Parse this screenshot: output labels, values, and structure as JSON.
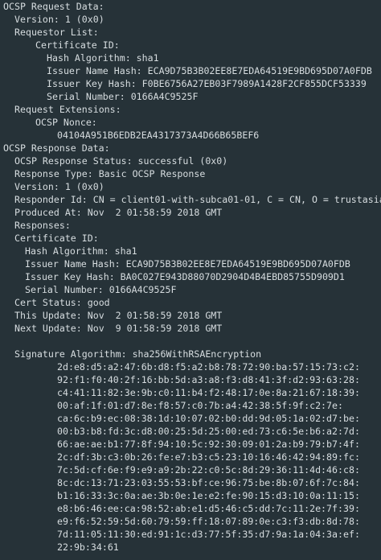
{
  "terminal": {
    "background": "#263238",
    "foreground": "#d7dde0",
    "lines": [
      {
        "indent": 0,
        "text": "OCSP Request Data:"
      },
      {
        "indent": 1,
        "text": "Version: 1 (0x0)"
      },
      {
        "indent": 1,
        "text": "Requestor List:"
      },
      {
        "indent": 3,
        "text": "Certificate ID:"
      },
      {
        "indent": 4,
        "text": "Hash Algorithm: sha1"
      },
      {
        "indent": 4,
        "text": "Issuer Name Hash: ECA9D75B3B02EE8E7EDA64519E9BD695D07A0FDB"
      },
      {
        "indent": 4,
        "text": "Issuer Key Hash: F0BE6756A27EB03F7989A1428F2CF855DCF53339"
      },
      {
        "indent": 4,
        "text": "Serial Number: 0166A4C9525F"
      },
      {
        "indent": 1,
        "text": "Request Extensions:"
      },
      {
        "indent": 3,
        "text": "OCSP Nonce:"
      },
      {
        "indent": 5,
        "text": "04104A951B6EDB2EA4317373A4D66B65BEF6"
      },
      {
        "indent": 0,
        "text": "OCSP Response Data:"
      },
      {
        "indent": 1,
        "text": "OCSP Response Status: successful (0x0)"
      },
      {
        "indent": 1,
        "text": "Response Type: Basic OCSP Response"
      },
      {
        "indent": 1,
        "text": "Version: 1 (0x0)"
      },
      {
        "indent": 1,
        "text": "Responder Id: CN = client01-with-subca01-01, C = CN, O = trustasia"
      },
      {
        "indent": 1,
        "text": "Produced At: Nov  2 01:58:59 2018 GMT"
      },
      {
        "indent": 1,
        "text": "Responses:"
      },
      {
        "indent": 1,
        "text": "Certificate ID:"
      },
      {
        "indent": 2,
        "text": "Hash Algorithm: sha1"
      },
      {
        "indent": 2,
        "text": "Issuer Name Hash: ECA9D75B3B02EE8E7EDA64519E9BD695D07A0FDB"
      },
      {
        "indent": 2,
        "text": "Issuer Key Hash: BA0C027E943D88070D2904D4B4EBD85755D909D1"
      },
      {
        "indent": 2,
        "text": "Serial Number: 0166A4C9525F"
      },
      {
        "indent": 1,
        "text": "Cert Status: good"
      },
      {
        "indent": 1,
        "text": "This Update: Nov  2 01:58:59 2018 GMT"
      },
      {
        "indent": 1,
        "text": "Next Update: Nov  9 01:58:59 2018 GMT"
      },
      {
        "indent": 0,
        "text": ""
      },
      {
        "indent": 1,
        "text": "Signature Algorithm: sha256WithRSAEncryption"
      },
      {
        "indent": 5,
        "text": "2d:e8:d5:a2:47:6b:d8:f5:a2:b8:78:72:90:ba:57:15:73:c2:"
      },
      {
        "indent": 5,
        "text": "92:f1:f0:40:2f:16:bb:5d:a3:a8:f3:d8:41:3f:d2:93:63:28:"
      },
      {
        "indent": 5,
        "text": "c4:41:11:82:3e:9b:c0:11:b4:f2:48:17:0e:8a:21:67:18:39:"
      },
      {
        "indent": 5,
        "text": "00:af:1f:01:d7:8e:f8:57:c0:7b:a4:42:38:5f:9f:c2:7e:"
      },
      {
        "indent": 5,
        "text": "ca:6c:b9:ec:08:38:1d:10:07:02:b0:dd:9d:05:1a:02:d7:be:"
      },
      {
        "indent": 5,
        "text": "00:b3:b8:fd:3c:d8:00:25:5d:25:00:ed:73:c6:5e:b6:a2:7d:"
      },
      {
        "indent": 5,
        "text": "66:ae:ae:b1:77:8f:94:10:5c:92:30:09:01:2a:b9:79:b7:4f:"
      },
      {
        "indent": 5,
        "text": "2c:df:3b:c3:0b:26:fe:e7:b3:c5:23:10:16:46:42:94:89:fc:"
      },
      {
        "indent": 5,
        "text": "7c:5d:cf:6e:f9:e9:a9:2b:22:c0:5c:8d:29:36:11:4d:46:c8:"
      },
      {
        "indent": 5,
        "text": "8c:dc:13:71:23:03:55:53:bf:ce:96:75:be:8b:07:6f:7c:84:"
      },
      {
        "indent": 5,
        "text": "b1:16:33:3c:0a:ae:3b:0e:1e:e2:fe:90:15:d3:10:0a:11:15:"
      },
      {
        "indent": 5,
        "text": "e8:b6:46:ee:ca:98:52:ab:e1:d5:46:c5:dd:7c:11:2e:7f:39:"
      },
      {
        "indent": 5,
        "text": "e9:f6:52:59:5d:60:79:59:ff:18:07:89:0e:c3:f3:db:8d:78:"
      },
      {
        "indent": 5,
        "text": "7d:11:05:11:30:ed:91:1c:d3:77:5f:35:d7:9a:1a:04:3a:ef:"
      },
      {
        "indent": 5,
        "text": "22:9b:34:61"
      }
    ]
  }
}
